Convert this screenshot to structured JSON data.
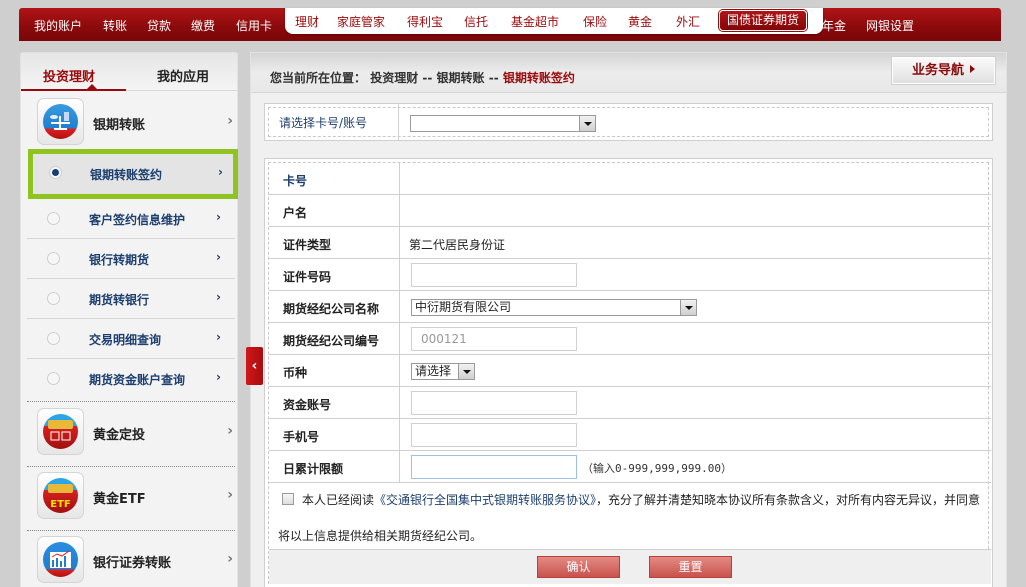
{
  "topnav": {
    "left_items": [
      "我的账户",
      "转账",
      "贷款",
      "缴费",
      "信用卡"
    ],
    "white_items": [
      "理财",
      "家庭管家",
      "得利宝",
      "信托",
      "基金超市",
      "保险",
      "黄金",
      "外汇"
    ],
    "active_item": "国债证券期货",
    "right_items": [
      "年金",
      "网银设置"
    ]
  },
  "sidebar": {
    "tabs": [
      "投资理财",
      "我的应用"
    ],
    "categories": [
      {
        "label": "银期转账",
        "icon": "scale-icon"
      },
      {
        "label": "黄金定投",
        "icon": "gold-calendar-icon"
      },
      {
        "label": "黄金ETF",
        "icon": "gold-etf-icon",
        "badge": "ETF"
      },
      {
        "label": "银行证券转账",
        "icon": "stock-chart-icon"
      }
    ],
    "sub_items": [
      {
        "label": "银期转账签约",
        "selected": true
      },
      {
        "label": "客户签约信息维护",
        "selected": false
      },
      {
        "label": "银行转期货",
        "selected": false
      },
      {
        "label": "期货转银行",
        "selected": false
      },
      {
        "label": "交易明细查询",
        "selected": false
      },
      {
        "label": "期货资金账户查询",
        "selected": false
      }
    ],
    "chevron": "›",
    "collapse_glyph": "‹"
  },
  "breadcrumb": {
    "prefix": "您当前所在位置：",
    "path": [
      "投资理财",
      "银期转账"
    ],
    "separator": " -- ",
    "current": "银期转账签约"
  },
  "nav_button": "业务导航",
  "card_select": {
    "label": "请选择卡号/账号",
    "value": ""
  },
  "form": {
    "fields": [
      {
        "label": "卡号",
        "value": ""
      },
      {
        "label": "户名",
        "value": ""
      },
      {
        "label": "证件类型",
        "value": "第二代居民身份证"
      },
      {
        "label": "证件号码",
        "value": ""
      },
      {
        "label": "期货经纪公司名称",
        "value": "中衍期货有限公司"
      },
      {
        "label": "期货经纪公司编号",
        "value": "000121"
      },
      {
        "label": "币种",
        "value": "请选择"
      },
      {
        "label": "资金账号",
        "value": ""
      },
      {
        "label": "手机号",
        "value": ""
      },
      {
        "label": "日累计限额",
        "value": "",
        "hint": "（输入0-999,999,999.00）"
      }
    ],
    "agreement": {
      "prefix": "本人已经阅读",
      "link": "《交通银行全国集中式银期转账服务协议》",
      "suffix": "，充分了解并清楚知晓本协议所有条款含义，对所有内容无异议，并同意",
      "line2": "将以上信息提供给相关期货经纪公司。",
      "checked": false
    },
    "confirm_label": "确认",
    "reset_label": "重置"
  }
}
